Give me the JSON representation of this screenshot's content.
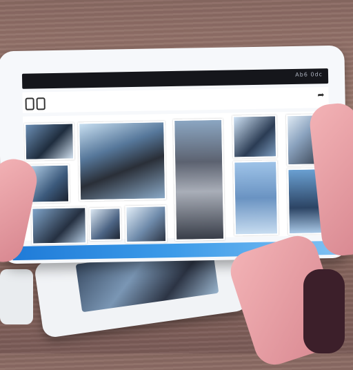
{
  "status_bar": {
    "text": "Ab6 0dc"
  },
  "toolbar": {
    "share_icon": "share-icon"
  },
  "gallery": {
    "photos": [
      "ph1",
      "ph2",
      "ph3",
      "ph4",
      "ph5",
      "ph6",
      "ph7",
      "ph8",
      "ph9",
      "ph10",
      "ph11"
    ]
  }
}
